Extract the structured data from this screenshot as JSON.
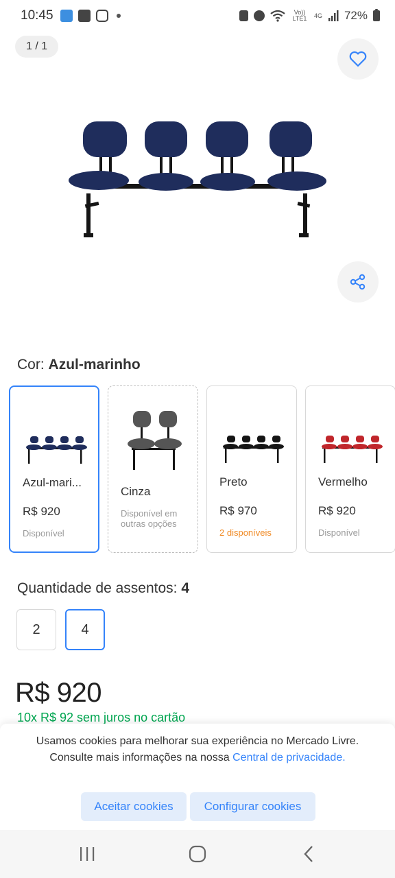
{
  "status_bar": {
    "time": "10:45",
    "network": "4G",
    "volte": "Vo)) LTE1",
    "battery": "72%"
  },
  "gallery": {
    "counter": "1 / 1"
  },
  "color_section": {
    "label": "Cor:",
    "selected": "Azul-marinho",
    "variants": [
      {
        "name": "Azul-mari...",
        "price": "R$ 920",
        "status": "Disponível",
        "seat_color": "#1f2d5c"
      },
      {
        "name": "Cinza",
        "price": "",
        "status": "Disponível em outras opções",
        "seat_color": "#555555"
      },
      {
        "name": "Preto",
        "price": "R$ 970",
        "status": "2 disponíveis",
        "seat_color": "#151515"
      },
      {
        "name": "Vermelho",
        "price": "R$ 920",
        "status": "Disponível",
        "seat_color": "#c0262b"
      }
    ]
  },
  "quantity_section": {
    "label": "Quantidade de assentos:",
    "selected": "4",
    "options": [
      "2",
      "4"
    ]
  },
  "price": {
    "main": "R$ 920",
    "installments": "10x R$ 92 sem juros no cartão"
  },
  "cookie_banner": {
    "text": "Usamos cookies para melhorar sua experiência no Mercado Livre. Consulte mais informações na nossa",
    "link": "Central de privacidade.",
    "accept": "Aceitar cookies",
    "configure": "Configurar cookies"
  },
  "colors": {
    "accent": "#3483fa",
    "green": "#00a650",
    "orange": "#f08a24"
  }
}
